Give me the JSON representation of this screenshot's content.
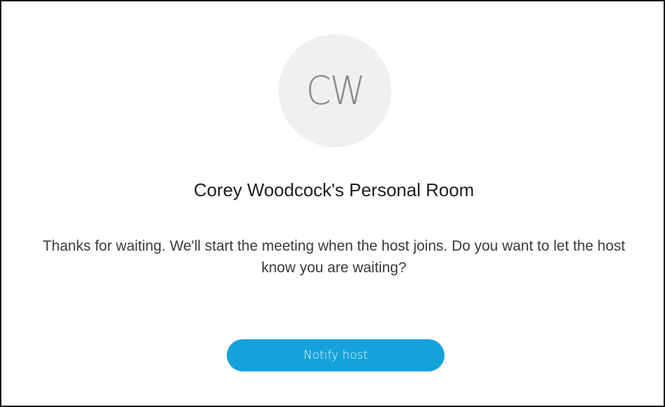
{
  "avatar": {
    "initials": "CW"
  },
  "room": {
    "title": "Corey Woodcock's Personal Room"
  },
  "message": {
    "text": "Thanks for waiting. We'll start the meeting when the host joins. Do you want to let the host know you are waiting?"
  },
  "actions": {
    "notify_label": "Notify host"
  },
  "colors": {
    "accent": "#14a2db",
    "avatar_bg": "#f0f0f0"
  }
}
